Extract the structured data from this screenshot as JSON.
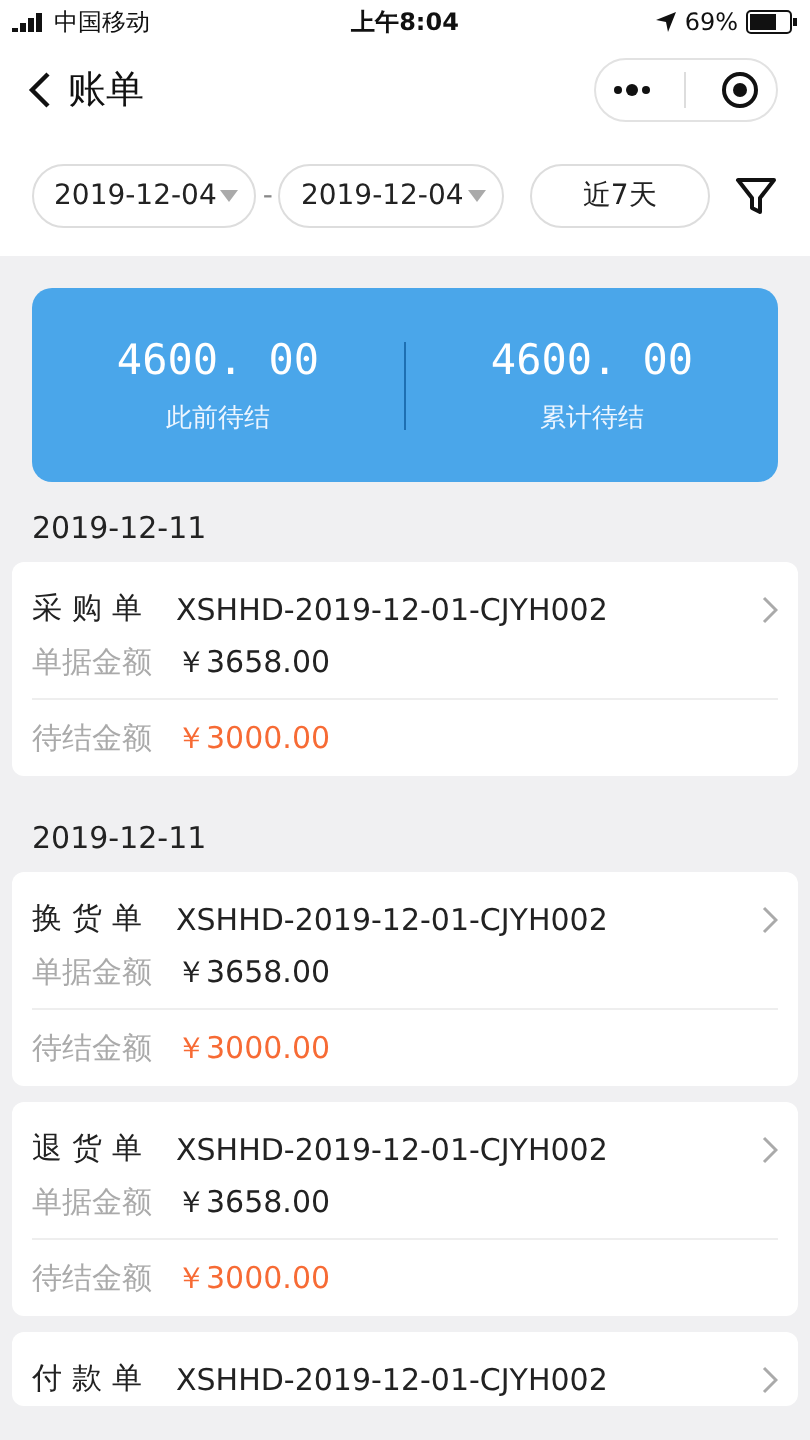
{
  "status_bar": {
    "carrier": "中国移动",
    "time": "上午8:04",
    "battery": "69%"
  },
  "nav": {
    "title": "账单"
  },
  "filter": {
    "start_date": "2019-12-04",
    "separator": "-",
    "end_date": "2019-12-04",
    "quick_button": "近7天"
  },
  "summary": [
    {
      "amount": "4600. 00",
      "label": "此前待结"
    },
    {
      "amount": "4600. 00",
      "label": "累计待结"
    }
  ],
  "groups": [
    {
      "date": "2019-12-11",
      "bills": [
        {
          "type": "采购单",
          "number": "XSHHD-2019-12-01-CJYH002",
          "amount_label": "单据金额",
          "amount": "￥3658.00",
          "pending_label": "待结金额",
          "pending": "￥3000.00"
        }
      ]
    },
    {
      "date": "2019-12-11",
      "bills": [
        {
          "type": "换货单",
          "number": "XSHHD-2019-12-01-CJYH002",
          "amount_label": "单据金额",
          "amount": "￥3658.00",
          "pending_label": "待结金额",
          "pending": "￥3000.00"
        },
        {
          "type": "退货单",
          "number": "XSHHD-2019-12-01-CJYH002",
          "amount_label": "单据金额",
          "amount": "￥3658.00",
          "pending_label": "待结金额",
          "pending": "￥3000.00"
        },
        {
          "type": "付款单",
          "number": "XSHHD-2019-12-01-CJYH002"
        }
      ]
    }
  ]
}
